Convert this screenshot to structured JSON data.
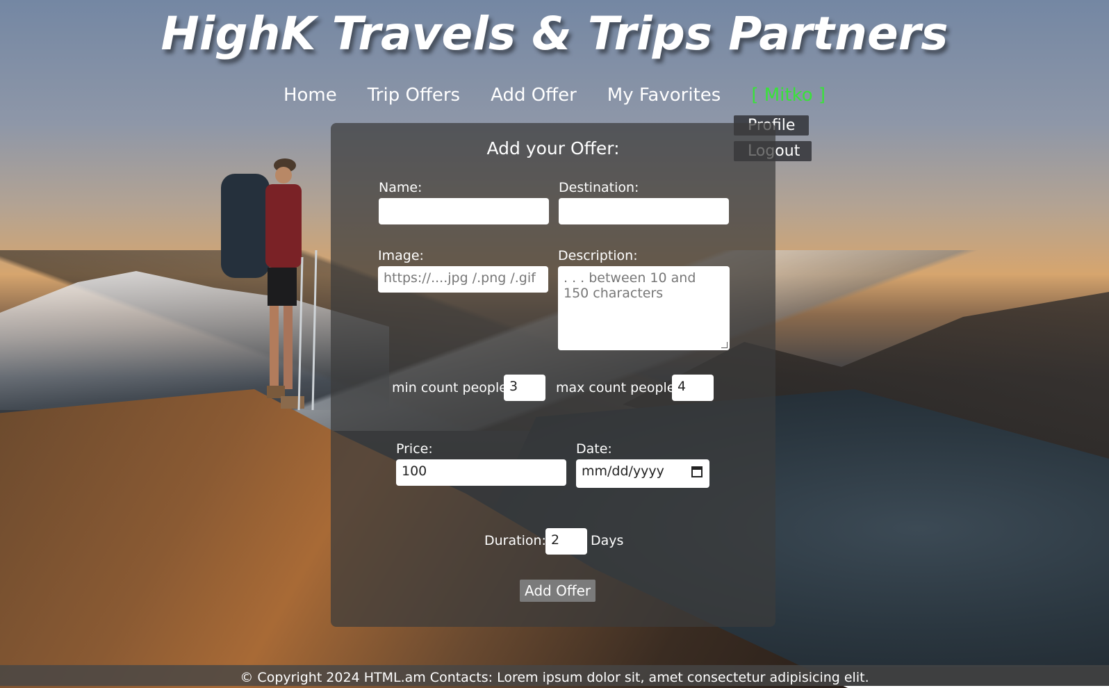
{
  "site": {
    "title": "HighK Travels & Trips Partners"
  },
  "nav": {
    "items": [
      {
        "label": "Home"
      },
      {
        "label": "Trip Offers"
      },
      {
        "label": "Add Offer"
      },
      {
        "label": "My Favorites"
      }
    ],
    "user": "[ Mitko ]",
    "user_color": "#39e23a",
    "dropdown": {
      "profile": "Profile",
      "logout": "Logout"
    }
  },
  "form": {
    "title": "Add your Offer:",
    "name": {
      "label": "Name:",
      "value": ""
    },
    "destination": {
      "label": "Destination:",
      "value": ""
    },
    "image": {
      "label": "Image:",
      "placeholder": "https://....jpg /.png /.gif"
    },
    "description": {
      "label": "Description:",
      "placeholder": ". . . between 10 and 150 characters"
    },
    "min_people": {
      "label": "min count people:",
      "value": "3"
    },
    "max_people": {
      "label": "max count people:",
      "value": "4"
    },
    "price": {
      "label": "Price:",
      "value": "100"
    },
    "date": {
      "label": "Date:",
      "placeholder": "mm/dd/yyyy"
    },
    "duration": {
      "label": "Duration:",
      "value": "2",
      "unit": "Days"
    },
    "submit": "Add Offer"
  },
  "footer": {
    "text": "© Copyright 2024 HTML.am Contacts: Lorem ipsum dolor sit, amet consectetur adipisicing elit."
  }
}
